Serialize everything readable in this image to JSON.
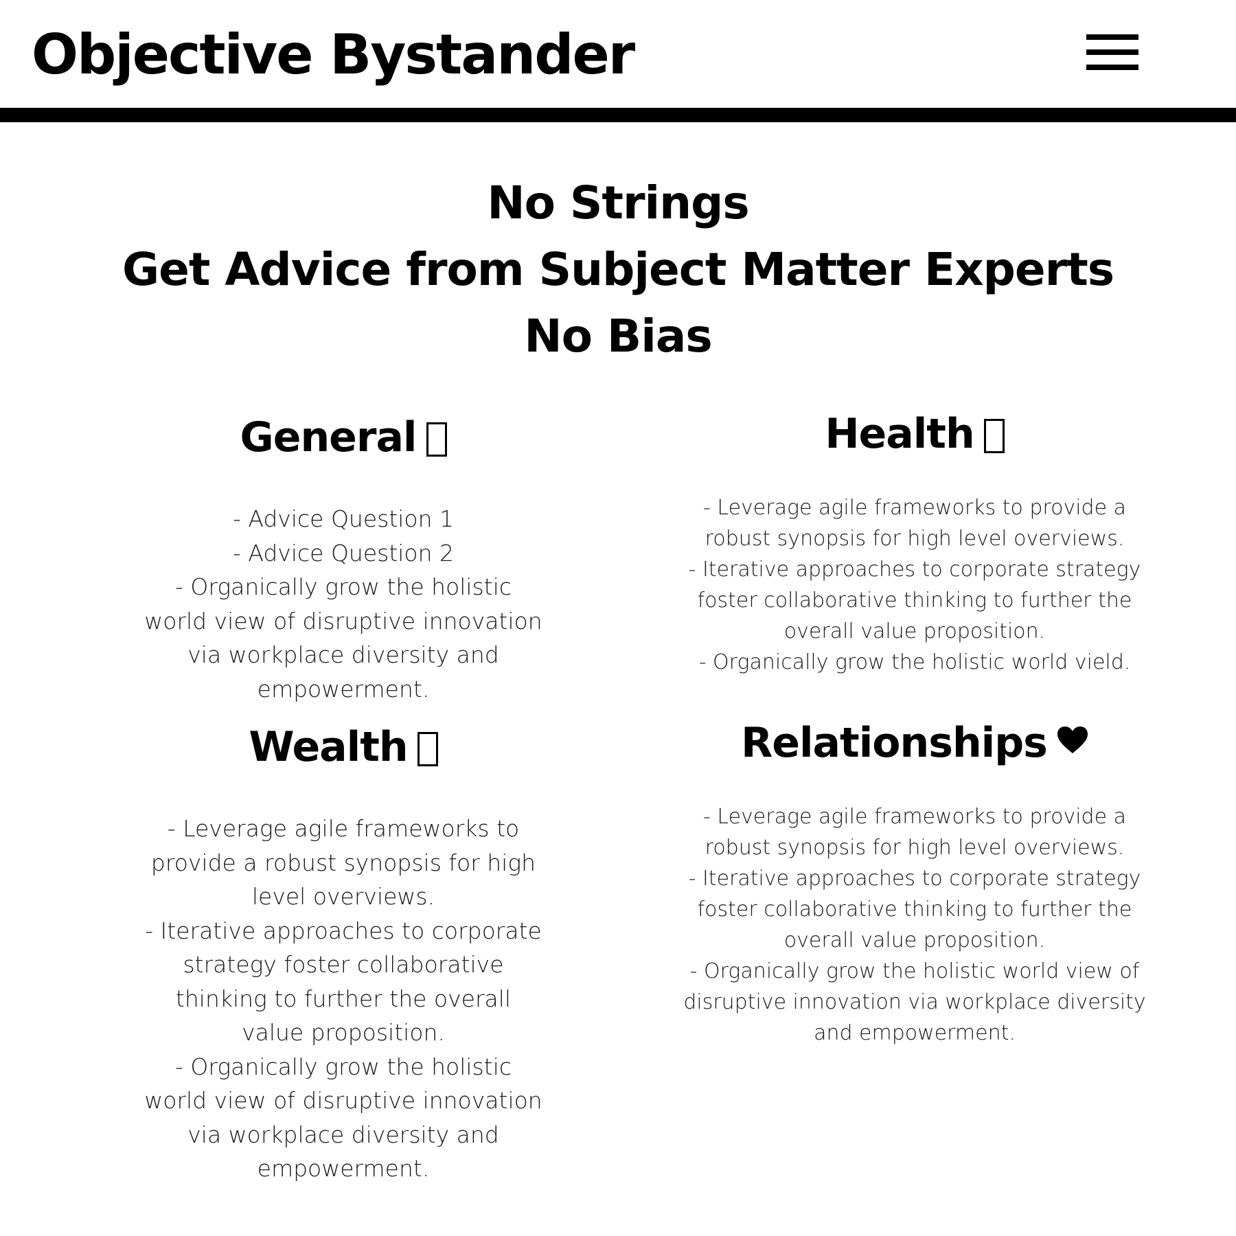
{
  "header": {
    "title": "Objective Bystander",
    "menu_icon": "hamburger-menu-icon"
  },
  "hero": {
    "lines": [
      "No Strings",
      "Get Advice from Subject Matter Experts",
      "No Bias"
    ]
  },
  "sections": [
    {
      "title": "General",
      "icon": "missing-glyph-icon",
      "items": [
        "- Advice Question 1",
        "- Advice Question 2",
        "- Organically grow the holistic world view of disruptive innovation via workplace diversity and empowerment."
      ]
    },
    {
      "title": "Health",
      "icon": "missing-glyph-icon",
      "items": [
        "- Leverage agile frameworks to provide a robust synopsis for high level overviews.",
        "- Iterative approaches to corporate strategy foster collaborative thinking to further the overall value proposition.",
        "- Organically grow the holistic world vield."
      ]
    },
    {
      "title": "Wealth",
      "icon": "missing-glyph-icon",
      "items": [
        "- Leverage agile frameworks to provide a robust synopsis for high level overviews.",
        "- Iterative approaches to corporate strategy foster collaborative thinking to further the overall value proposition.",
        "- Organically grow the holistic world view of disruptive innovation via workplace diversity and empowerment."
      ]
    },
    {
      "title": "Relationships",
      "icon": "heart-icon",
      "items": [
        "- Leverage agile frameworks to provide a robust synopsis for high level overviews.",
        "- Iterative approaches to corporate strategy foster collaborative thinking to further the overall value proposition.",
        "- Organically grow the holistic world view of disruptive innovation via workplace diversity and empowerment."
      ]
    }
  ]
}
